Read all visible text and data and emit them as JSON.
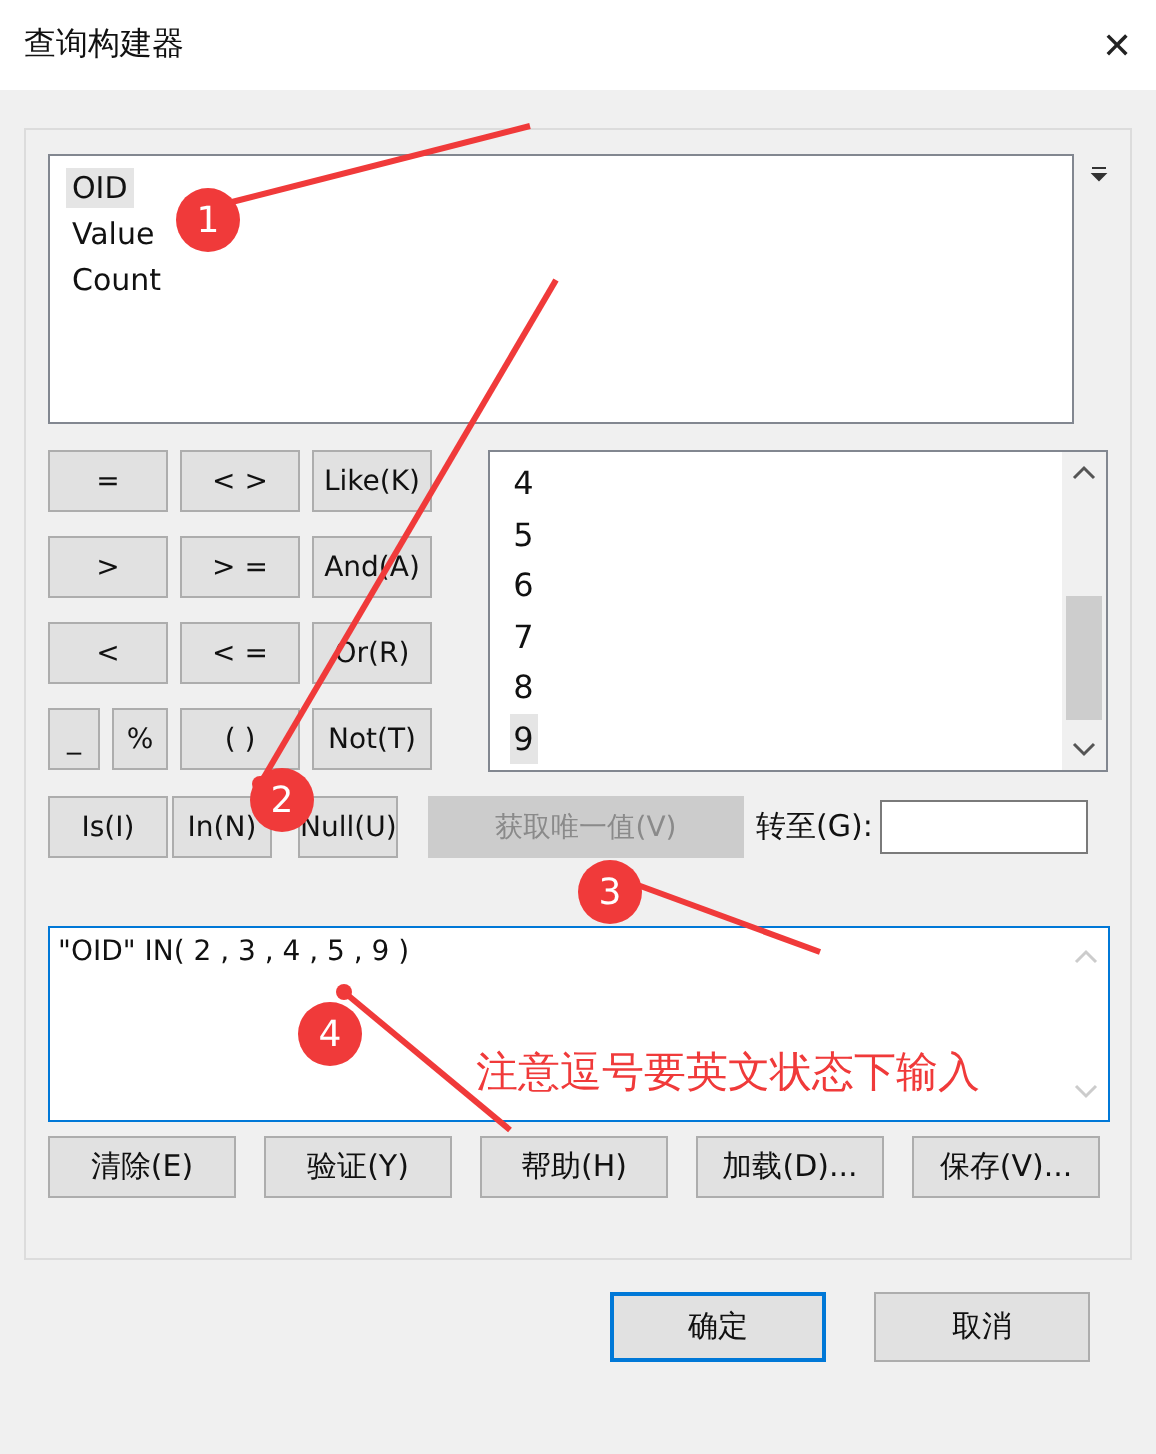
{
  "window": {
    "title": "查询构建器",
    "close": "✕"
  },
  "fields": [
    {
      "label": "OID",
      "selected": true
    },
    {
      "label": "Value",
      "selected": false
    },
    {
      "label": "Count",
      "selected": false
    }
  ],
  "operators": [
    {
      "label": "="
    },
    {
      "label": "< >"
    },
    {
      "label": "Like(K)"
    },
    {
      "label": ">"
    },
    {
      "label": "> ="
    },
    {
      "label": "And(A)"
    },
    {
      "label": "<"
    },
    {
      "label": "< ="
    },
    {
      "label": "Or(R)"
    },
    {
      "label": "_"
    },
    {
      "label": "%"
    },
    {
      "label": "( )"
    },
    {
      "label": "Not(T)"
    }
  ],
  "values": [
    {
      "label": "4",
      "selected": false
    },
    {
      "label": "5",
      "selected": false
    },
    {
      "label": "6",
      "selected": false
    },
    {
      "label": "7",
      "selected": false
    },
    {
      "label": "8",
      "selected": false
    },
    {
      "label": "9",
      "selected": true
    }
  ],
  "row_buttons": [
    {
      "label": "Is(I)",
      "disabled": false
    },
    {
      "label": "In(N)",
      "disabled": false
    },
    {
      "label": "Null(U)",
      "disabled": false
    },
    {
      "label": "获取唯一值(V)",
      "disabled": true
    }
  ],
  "goto": {
    "label": "转至(G):"
  },
  "expression": "\"OID\" IN( 2 , 3 , 4 , 5 , 9 )",
  "actions": [
    "清除(E)",
    "验证(Y)",
    "帮助(H)",
    "加载(D)...",
    "保存(V)..."
  ],
  "dialog_buttons": [
    {
      "label": "确定",
      "default": true
    },
    {
      "label": "取消",
      "default": false
    }
  ],
  "annotations": [
    {
      "label": "1"
    },
    {
      "label": "2"
    },
    {
      "label": "3"
    },
    {
      "label": "4"
    }
  ],
  "note": "注意逗号要英文状态下输入"
}
